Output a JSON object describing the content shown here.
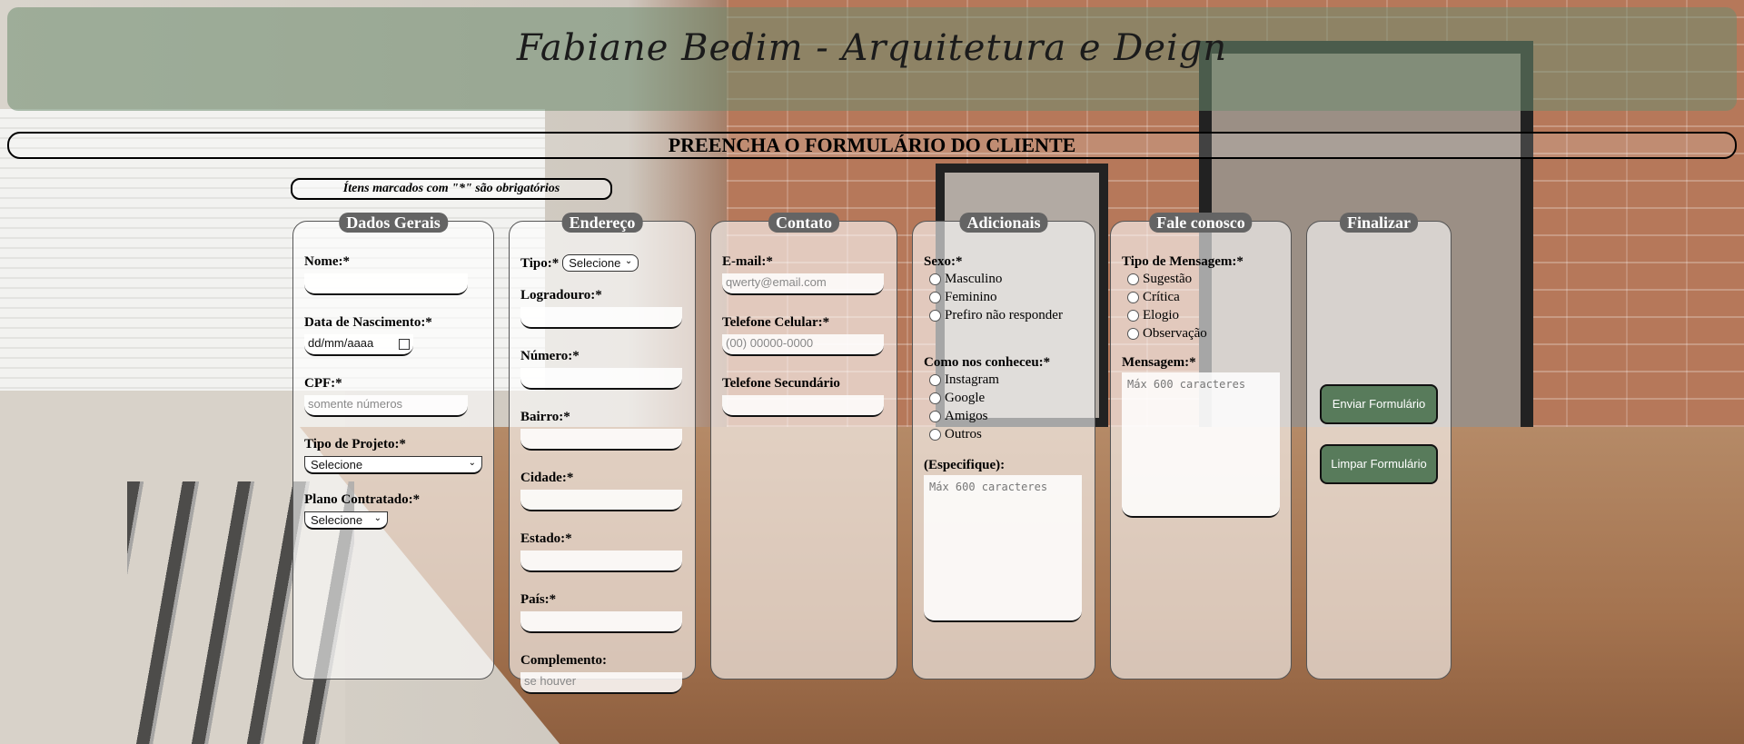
{
  "header": {
    "logo_text": "Fabiane Bedim - Arquitetura e Deign"
  },
  "title": "PREENCHA O FORMULÁRIO DO CLIENTE",
  "required_note": "Ítens marcados com \"*\" são obrigatórios",
  "dados_gerais": {
    "legend": "Dados Gerais",
    "nome_label": "Nome:*",
    "nascimento_label": "Data de Nascimento:*",
    "nascimento_placeholder": "dd/mm/aaaa",
    "cpf_label": "CPF:*",
    "cpf_placeholder": "somente números",
    "tipo_projeto_label": "Tipo de Projeto:*",
    "tipo_projeto_value": "Selecione",
    "plano_label": "Plano Contratado:*",
    "plano_value": "Selecione"
  },
  "endereco": {
    "legend": "Endereço",
    "tipo_label": "Tipo:*",
    "tipo_value": "Selecione",
    "logradouro_label": "Logradouro:*",
    "numero_label": "Número:*",
    "bairro_label": "Bairro:*",
    "cidade_label": "Cidade:*",
    "estado_label": "Estado:*",
    "pais_label": "País:*",
    "complemento_label": "Complemento:",
    "complemento_placeholder": "se houver"
  },
  "contato": {
    "legend": "Contato",
    "email_label": "E-mail:*",
    "email_placeholder": "qwerty@email.com",
    "celular_label": "Telefone Celular:*",
    "celular_placeholder": "(00) 00000-0000",
    "secundario_label": "Telefone Secundário"
  },
  "adicionais": {
    "legend": "Adicionais",
    "sexo_label": "Sexo:*",
    "sexo_options": [
      "Masculino",
      "Feminino",
      "Prefiro não responder"
    ],
    "conheceu_label": "Como nos conheceu:*",
    "conheceu_options": [
      "Instagram",
      "Google",
      "Amigos",
      "Outros"
    ],
    "especifique_label": "(Especifique):",
    "especifique_placeholder": "Máx 600 caracteres"
  },
  "fale_conosco": {
    "legend": "Fale conosco",
    "tipo_label": "Tipo de Mensagem:*",
    "tipo_options": [
      "Sugestão",
      "Crítica",
      "Elogio",
      "Observação"
    ],
    "mensagem_label": "Mensagem:*",
    "mensagem_placeholder": "Máx 600 caracteres"
  },
  "finalizar": {
    "legend": "Finalizar",
    "enviar_label": "Enviar Formulário",
    "limpar_label": "Limpar Formulário"
  }
}
